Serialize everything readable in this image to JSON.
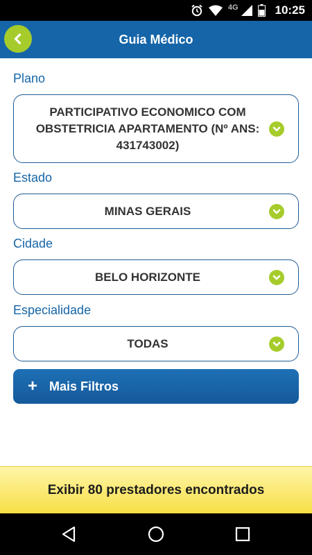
{
  "status_bar": {
    "network": "4G",
    "time": "10:25",
    "icons": [
      "alarm-icon",
      "wifi-icon",
      "signal-icon",
      "battery-icon"
    ]
  },
  "header": {
    "title": "Guia Médico",
    "back_icon": "chevron-left-icon",
    "accent_color": "#a6cc2c",
    "bar_color": "#1565a8"
  },
  "form": {
    "plano": {
      "label": "Plano",
      "value": "PARTICIPATIVO ECONOMICO COM OBSTETRICIA APARTAMENTO (Nº ANS: 431743002)"
    },
    "estado": {
      "label": "Estado",
      "value": "MINAS GERAIS"
    },
    "cidade": {
      "label": "Cidade",
      "value": "BELO HORIZONTE"
    },
    "especialidade": {
      "label": "Especialidade",
      "value": "TODAS"
    },
    "dropdown_icon": "chevron-down-icon"
  },
  "more_filters": {
    "icon": "+",
    "label": "Mais Filtros"
  },
  "results": {
    "label": "Exibir 80 prestadores encontrados",
    "count": 80
  },
  "nav_bar": {
    "icons": [
      "back-triangle-icon",
      "home-circle-icon",
      "recents-square-icon"
    ]
  }
}
